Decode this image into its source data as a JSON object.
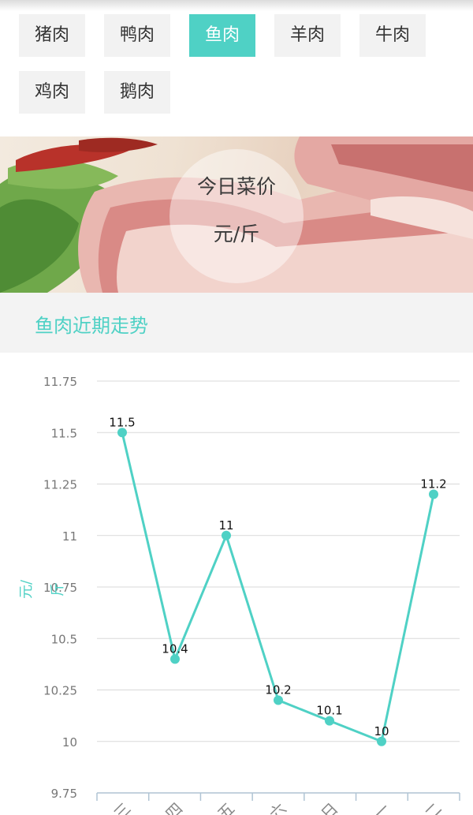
{
  "tabs": [
    {
      "label": "猪肉",
      "active": false
    },
    {
      "label": "鸭肉",
      "active": false
    },
    {
      "label": "鱼肉",
      "active": true
    },
    {
      "label": "羊肉",
      "active": false
    },
    {
      "label": "牛肉",
      "active": false
    },
    {
      "label": "鸡肉",
      "active": false
    },
    {
      "label": "鹅肉",
      "active": false
    }
  ],
  "banner": {
    "title": "今日菜价",
    "unit": "元/斤"
  },
  "section": {
    "title": "鱼肉近期走势"
  },
  "colors": {
    "accent": "#4fd1c5",
    "tab_bg": "#f2f2f2",
    "header_bg": "#f3f3f3"
  },
  "chart_data": {
    "type": "line",
    "ylabel": "元/斤",
    "ylim": [
      9.75,
      11.75
    ],
    "yticks": [
      "11.75",
      "11.5",
      "11.25",
      "11",
      "10.75",
      "10.5",
      "10.25",
      "10",
      "9.75"
    ],
    "categories": [
      "三",
      "四",
      "五",
      "六",
      "日",
      "一",
      "二"
    ],
    "values": [
      11.5,
      10.4,
      11,
      10.2,
      10.1,
      10,
      11.2
    ],
    "point_labels": [
      "11.5",
      "10.4",
      "11",
      "10.2",
      "10.1",
      "10",
      "11.2"
    ],
    "grid": true
  }
}
